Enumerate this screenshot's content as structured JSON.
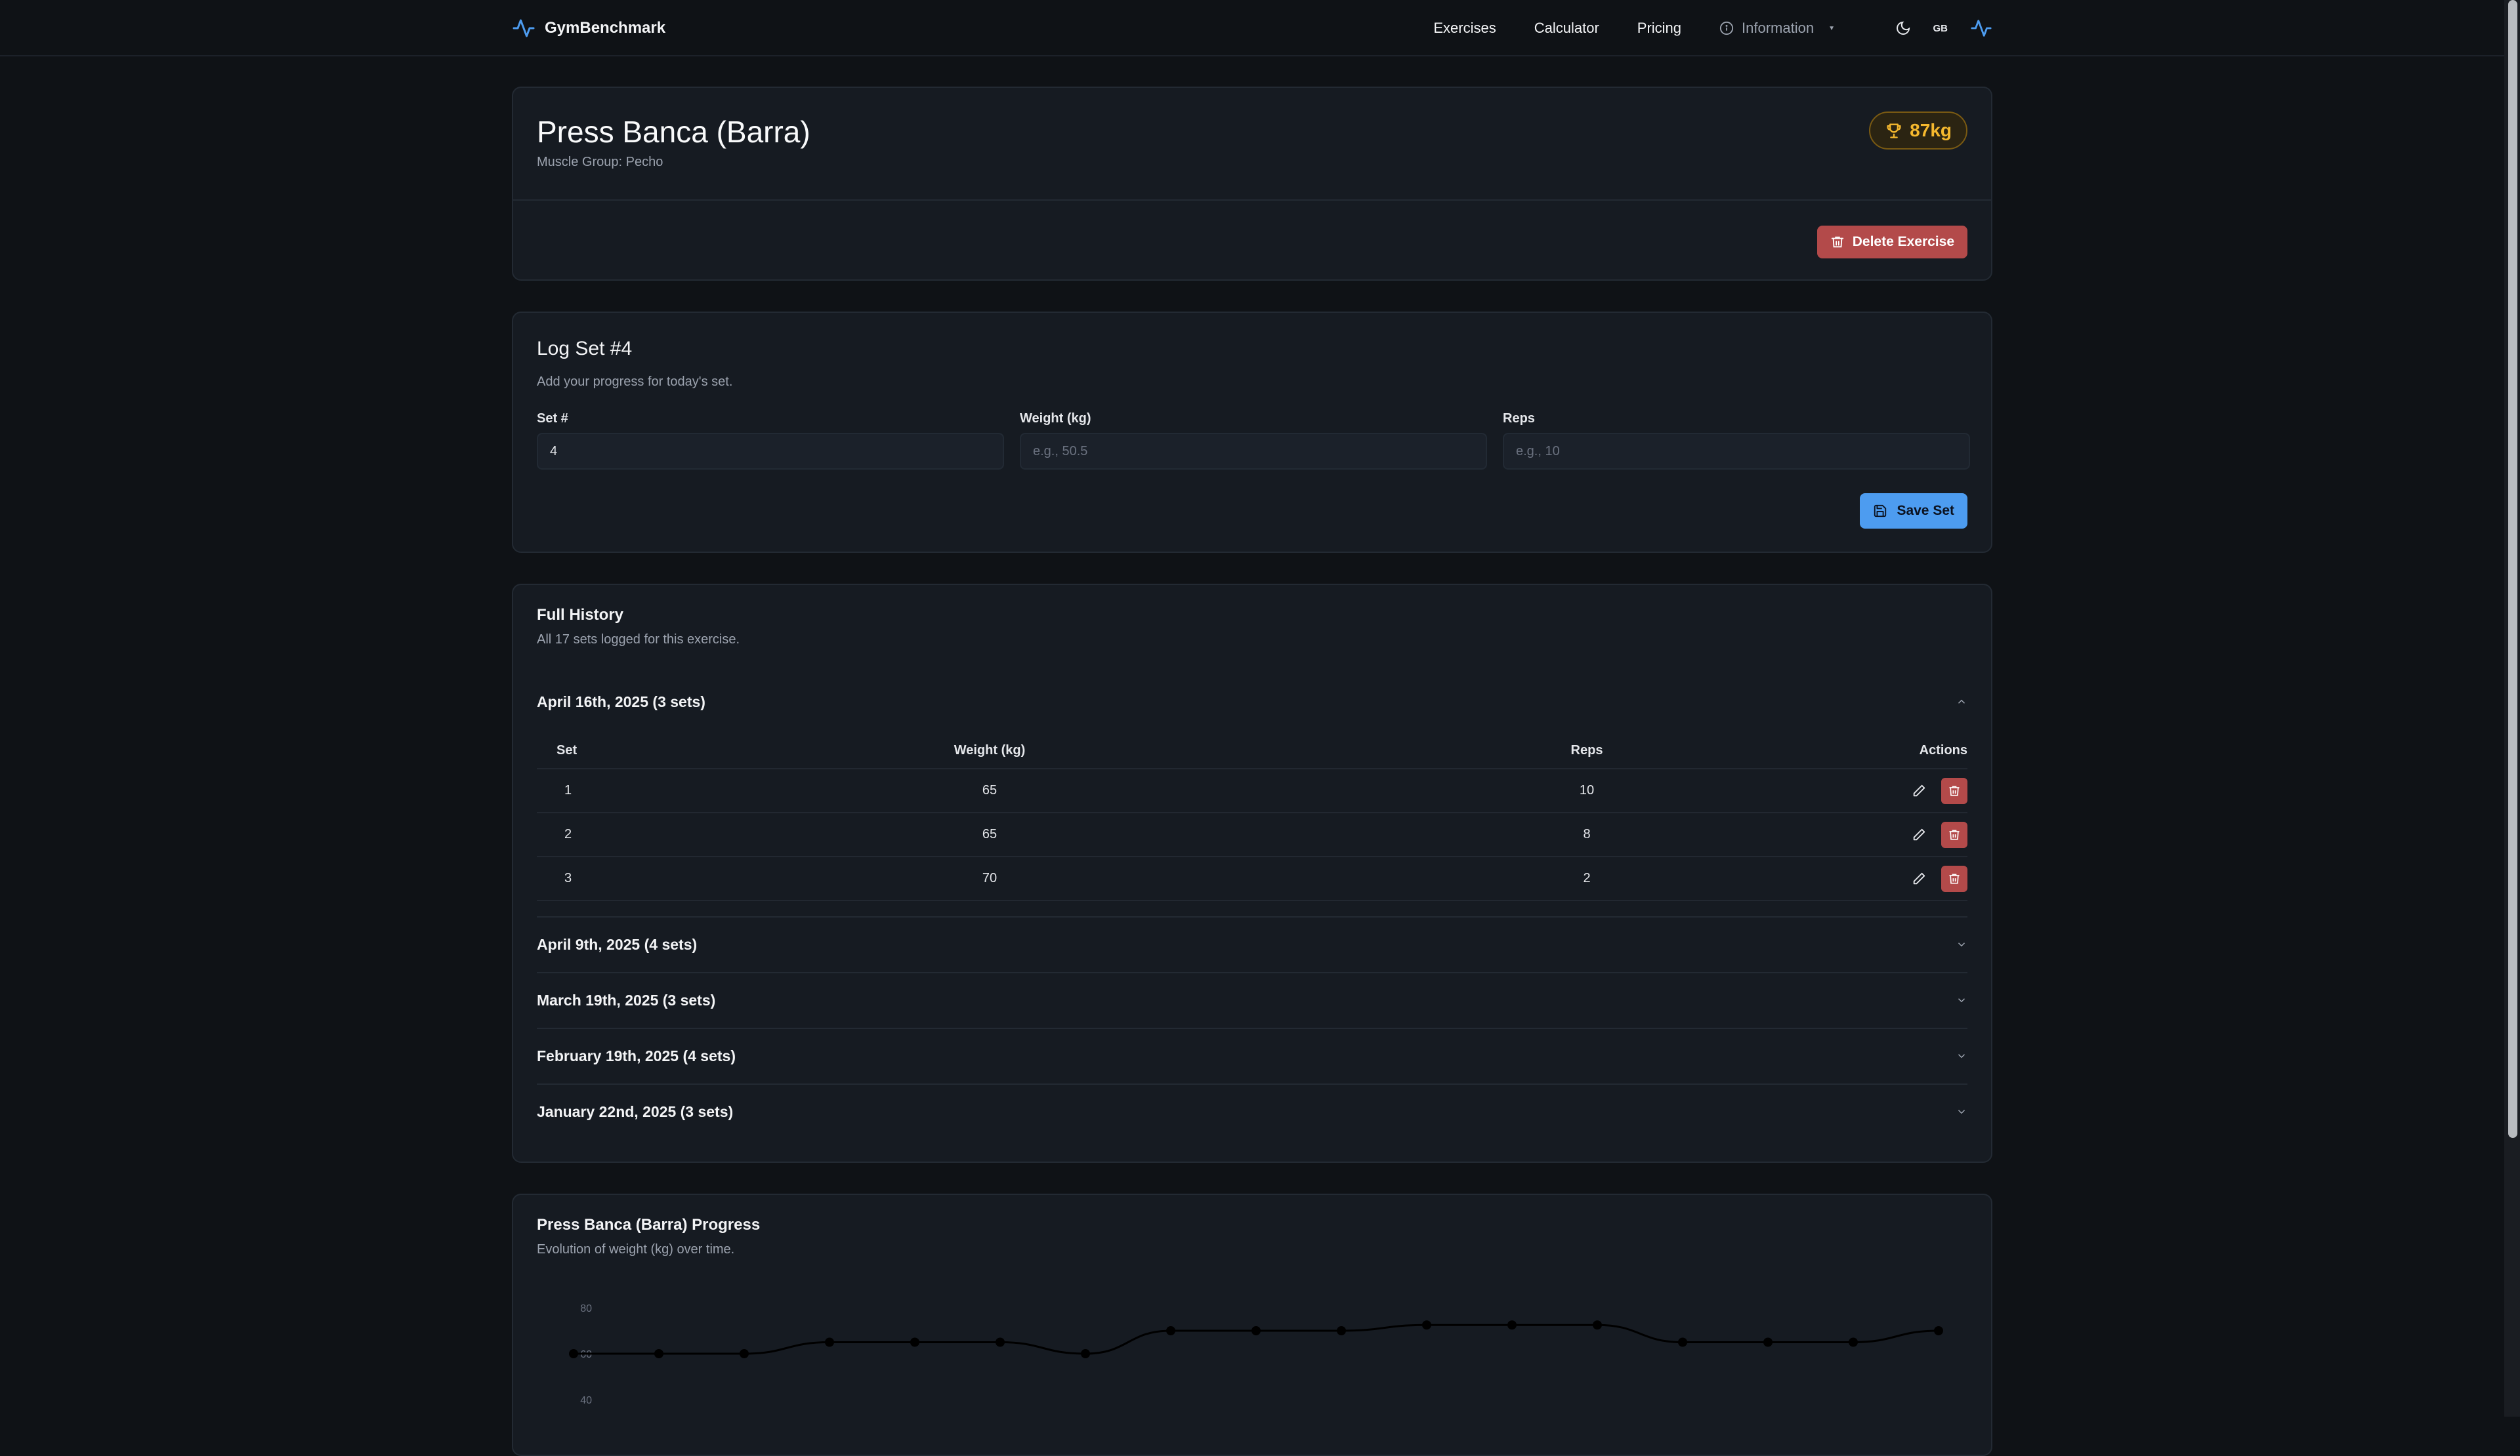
{
  "nav": {
    "brand": "GymBenchmark",
    "links": [
      "Exercises",
      "Calculator",
      "Pricing"
    ],
    "info_label": "Information",
    "lang": "GB",
    "accent_color": "#4d9cf0"
  },
  "exercise": {
    "title": "Press Banca (Barra)",
    "muscle_group": "Muscle Group: Pecho",
    "pr": "87kg",
    "delete_label": "Delete Exercise"
  },
  "log": {
    "title": "Log Set #4",
    "subtitle": "Add your progress for today's set.",
    "set_label": "Set #",
    "set_value": "4",
    "weight_label": "Weight (kg)",
    "weight_placeholder": "e.g., 50.5",
    "reps_label": "Reps",
    "reps_placeholder": "e.g., 10",
    "save_label": "Save Set"
  },
  "history": {
    "title": "Full History",
    "subtitle": "All 17 sets logged for this exercise.",
    "columns": [
      "Set",
      "Weight (kg)",
      "Reps",
      "Actions"
    ],
    "groups": [
      {
        "label": "April 16th, 2025 (3 sets)",
        "expanded": true,
        "rows": [
          {
            "set": "1",
            "weight": "65",
            "reps": "10"
          },
          {
            "set": "2",
            "weight": "65",
            "reps": "8"
          },
          {
            "set": "3",
            "weight": "70",
            "reps": "2"
          }
        ]
      },
      {
        "label": "April 9th, 2025 (4 sets)",
        "expanded": false
      },
      {
        "label": "March 19th, 2025 (3 sets)",
        "expanded": false
      },
      {
        "label": "February 19th, 2025 (4 sets)",
        "expanded": false
      },
      {
        "label": "January 22nd, 2025 (3 sets)",
        "expanded": false
      }
    ]
  },
  "progress": {
    "title": "Press Banca (Barra) Progress",
    "subtitle": "Evolution of weight (kg) over time."
  },
  "chart_data": {
    "type": "line",
    "title": "Press Banca (Barra) Progress",
    "ylim": [
      40,
      80
    ],
    "yticks": [
      "80",
      "60",
      "40"
    ],
    "series": [
      {
        "values": [
          60,
          60,
          60,
          65,
          65,
          65,
          60,
          70,
          70,
          70,
          72.5,
          72.5,
          72.5,
          65,
          65,
          65,
          70
        ]
      }
    ],
    "grid": false
  }
}
